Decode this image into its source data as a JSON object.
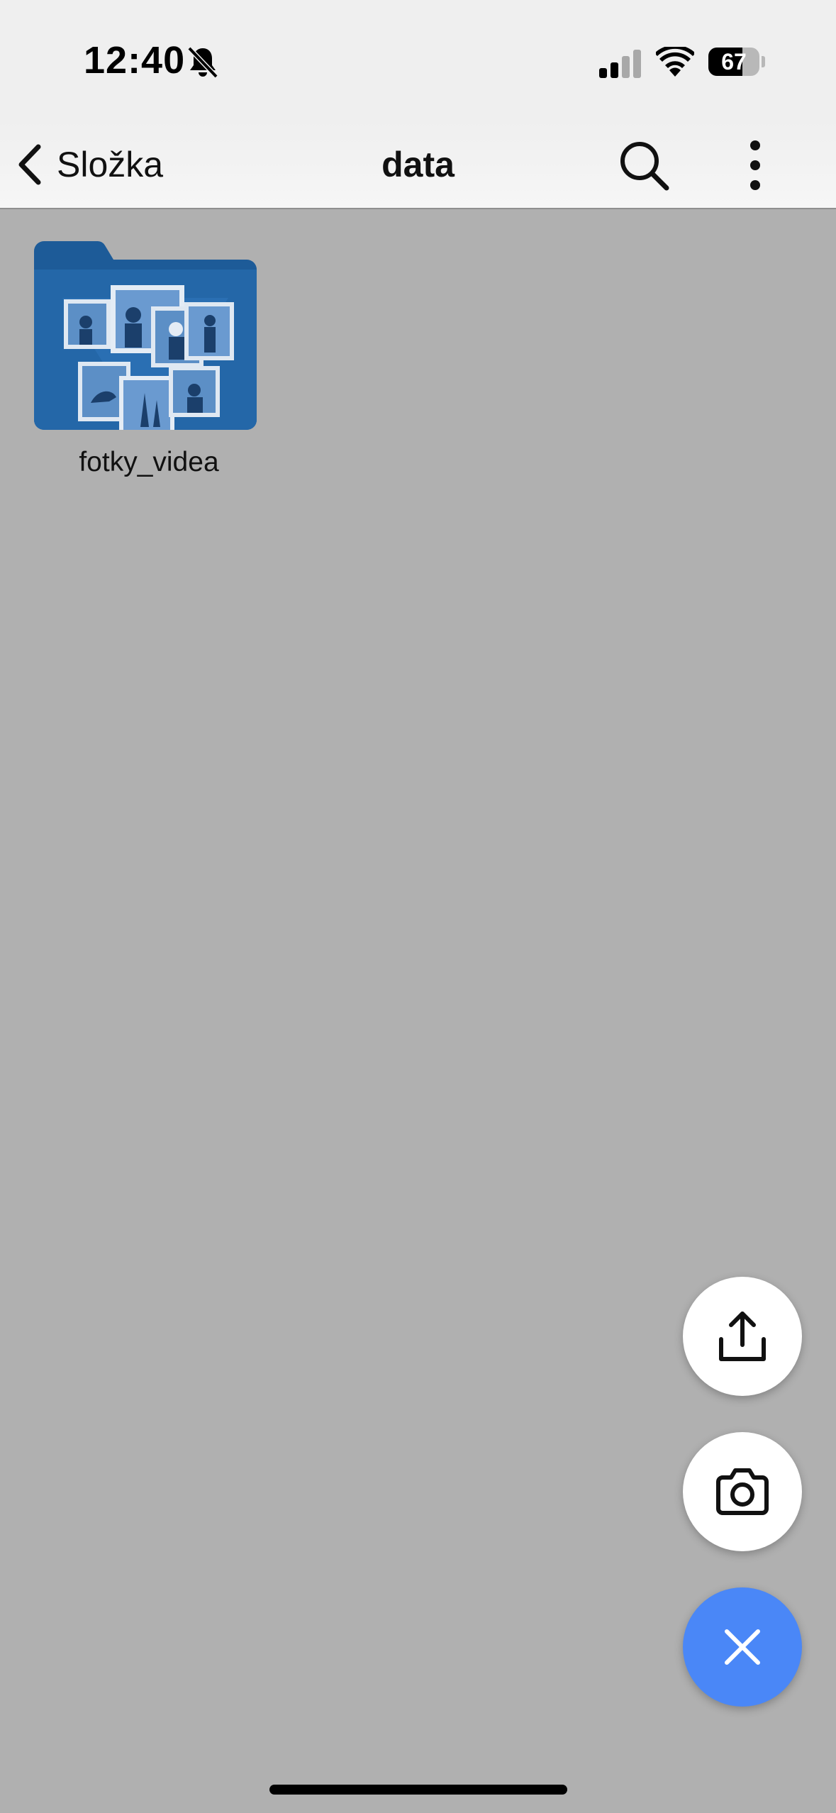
{
  "status_bar": {
    "time": "12:40",
    "battery_percent": "67",
    "battery_level": 0.67,
    "icons": [
      "bell-off-icon",
      "cellular-signal-icon",
      "wifi-icon",
      "battery-icon"
    ]
  },
  "nav": {
    "back_label": "Složka",
    "title": "data",
    "icons": [
      "chevron-left-icon",
      "search-icon",
      "more-vertical-icon"
    ]
  },
  "items": [
    {
      "name": "fotky_videa",
      "type": "folder",
      "icon": "photo-folder-icon"
    }
  ],
  "fabs": [
    {
      "name": "upload",
      "icon": "upload-icon"
    },
    {
      "name": "camera",
      "icon": "camera-icon"
    },
    {
      "name": "close",
      "icon": "close-icon"
    }
  ],
  "colors": {
    "background_overlay": "#b0b0b0",
    "bar_background": "#efefef",
    "fab_accent": "#4a87f7",
    "folder_blue": "#1f5d9c"
  }
}
